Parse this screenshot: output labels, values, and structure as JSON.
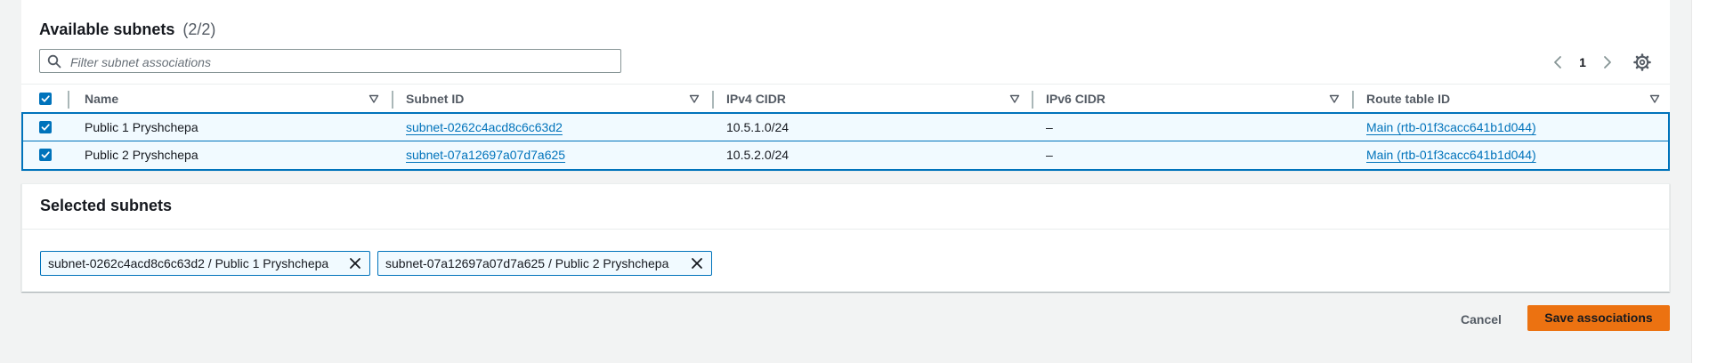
{
  "available": {
    "title": "Available subnets",
    "count": "(2/2)",
    "filter_placeholder": "Filter subnet associations",
    "page": "1",
    "columns": [
      "Name",
      "Subnet ID",
      "IPv4 CIDR",
      "IPv6 CIDR",
      "Route table ID"
    ],
    "rows": [
      {
        "name": "Public 1 Pryshchepa",
        "subnet_id": "subnet-0262c4acd8c6c63d2",
        "ipv4": "10.5.1.0/24",
        "ipv6": "–",
        "route_table": "Main (rtb-01f3cacc641b1d044)",
        "selected": true
      },
      {
        "name": "Public 2 Pryshchepa",
        "subnet_id": "subnet-07a12697a07d7a625",
        "ipv4": "10.5.2.0/24",
        "ipv6": "–",
        "route_table": "Main (rtb-01f3cacc641b1d044)",
        "selected": true
      }
    ]
  },
  "selected": {
    "title": "Selected subnets",
    "tokens": [
      "subnet-0262c4acd8c6c63d2 / Public 1 Pryshchepa",
      "subnet-07a12697a07d7a625 / Public 2 Pryshchepa"
    ]
  },
  "actions": {
    "cancel": "Cancel",
    "save": "Save associations"
  },
  "colors": {
    "accent": "#0073bb",
    "primary_button": "#ec7211",
    "row_selected_bg": "#f1faff"
  },
  "icons": {
    "search": "search-icon",
    "prev": "chevron-left-icon",
    "next": "chevron-right-icon",
    "settings": "gear-icon",
    "sort": "sort-down-icon",
    "checkbox": "checkbox-checked-icon",
    "dismiss": "close-icon"
  }
}
